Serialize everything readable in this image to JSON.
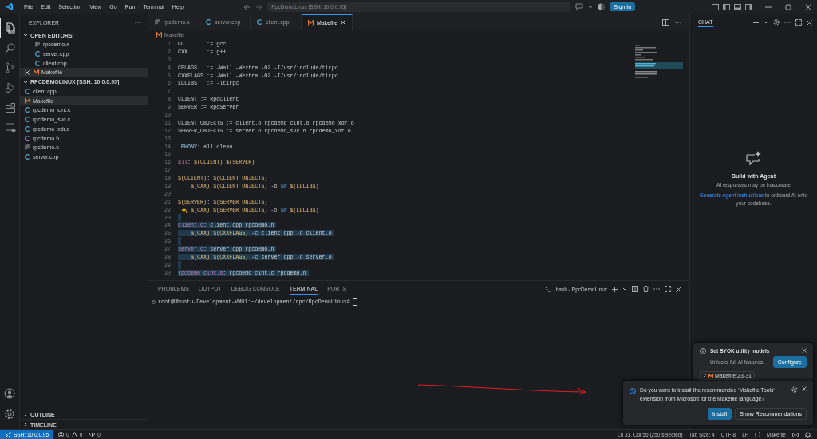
{
  "title_bar": {
    "menu": [
      "File",
      "Edit",
      "Selection",
      "View",
      "Go",
      "Run",
      "Terminal",
      "Help"
    ],
    "command_center": "RpcDemoLinux [SSH: 10.0.0.95]",
    "sign_in": "Sign In"
  },
  "activity_bar": [
    {
      "kind": "files",
      "selected": true
    },
    {
      "kind": "search",
      "selected": false
    },
    {
      "kind": "source-control",
      "selected": false
    },
    {
      "kind": "run",
      "selected": false
    },
    {
      "kind": "extensions",
      "selected": false
    },
    {
      "kind": "remote",
      "selected": false
    }
  ],
  "sidebar": {
    "title": "EXPLORER",
    "open_editors": {
      "title": "OPEN EDITORS",
      "expanded": true,
      "items": [
        {
          "name": "rpcdemo.x",
          "kind": "text",
          "selected": false
        },
        {
          "name": "server.cpp",
          "kind": "cpp",
          "selected": false
        },
        {
          "name": "client.cpp",
          "kind": "cpp",
          "selected": false
        },
        {
          "name": "Makefile",
          "kind": "makefile",
          "selected": true
        }
      ]
    },
    "folder": {
      "title": "RPCDEMOLINUX [SSH: 10.0.0.95]",
      "expanded": true,
      "items": [
        {
          "name": "client.cpp",
          "kind": "cpp",
          "selected": false
        },
        {
          "name": "Makefile",
          "kind": "makefile",
          "selected": true
        },
        {
          "name": "rpcdemo_clnt.c",
          "kind": "c",
          "selected": false
        },
        {
          "name": "rpcdemo_svc.c",
          "kind": "c",
          "selected": false
        },
        {
          "name": "rpcdemo_xdr.c",
          "kind": "c",
          "selected": false
        },
        {
          "name": "rpcdemo.h",
          "kind": "h",
          "selected": false
        },
        {
          "name": "rpcdemo.x",
          "kind": "text",
          "selected": false
        },
        {
          "name": "server.cpp",
          "kind": "cpp",
          "selected": false
        }
      ]
    },
    "collapsed_sections": [
      {
        "title": "OUTLINE",
        "expanded": false
      },
      {
        "title": "TIMELINE",
        "expanded": false
      }
    ]
  },
  "editor": {
    "tabs": [
      {
        "name": "rpcdemo.x",
        "kind": "text",
        "selected": false
      },
      {
        "name": "server.cpp",
        "kind": "cpp",
        "selected": false
      },
      {
        "name": "client.cpp",
        "kind": "cpp",
        "selected": false
      },
      {
        "name": "Makefile",
        "kind": "makefile",
        "selected": true
      }
    ],
    "breadcrumb": "Makefile",
    "lines": [
      {
        "number": "1",
        "selected": false,
        "tokens": [
          {
            "text": "CC       := gcc",
            "kind": "plain"
          }
        ]
      },
      {
        "number": "2",
        "selected": false,
        "tokens": [
          {
            "text": "CXX      := g++",
            "kind": "plain"
          }
        ]
      },
      {
        "number": "3",
        "selected": false
      },
      {
        "number": "4",
        "selected": false,
        "tokens": [
          {
            "text": "CFLAGS   := -Wall -Wextra -O2 -I/usr/include/tirpc",
            "kind": "plain"
          }
        ]
      },
      {
        "number": "5",
        "selected": false,
        "tokens": [
          {
            "text": "CXXFLAGS := -Wall -Wextra -O2 -I/usr/include/tirpc",
            "kind": "plain"
          }
        ]
      },
      {
        "number": "6",
        "selected": false,
        "tokens": [
          {
            "text": "LDLIBS   := -ltirpc",
            "kind": "plain"
          }
        ]
      },
      {
        "number": "7",
        "selected": false
      },
      {
        "number": "8",
        "selected": false,
        "tokens": [
          {
            "text": "CLIENT := RpcClient",
            "kind": "plain"
          }
        ]
      },
      {
        "number": "9",
        "selected": false,
        "tokens": [
          {
            "text": "SERVER := RpcServer",
            "kind": "plain"
          }
        ]
      },
      {
        "number": "10",
        "selected": false
      },
      {
        "number": "11",
        "selected": false,
        "tokens": [
          {
            "text": "CLIENT_OBJECTS := client.o rpcdemo_clnt.o rpcdemo_xdr.o",
            "kind": "plain"
          }
        ]
      },
      {
        "number": "12",
        "selected": false,
        "tokens": [
          {
            "text": "SERVER_OBJECTS := server.o rpcdemo_svc.o rpcdemo_xdr.o",
            "kind": "plain"
          }
        ]
      },
      {
        "number": "13",
        "selected": false
      },
      {
        "number": "14",
        "selected": false,
        "tokens": [
          {
            "text": ".PHONY",
            "kind": "special"
          },
          {
            "text": ": all clean",
            "kind": "plain"
          }
        ]
      },
      {
        "number": "15",
        "selected": false
      },
      {
        "number": "16",
        "selected": false,
        "tokens": [
          {
            "text": "all",
            "kind": "target"
          },
          {
            "text": ": ",
            "kind": "plain"
          },
          {
            "text": "$(CLIENT)",
            "kind": "variable"
          },
          {
            "text": " $(SERVER)",
            "kind": "variable"
          }
        ]
      },
      {
        "number": "17",
        "selected": false
      },
      {
        "number": "18",
        "selected": false,
        "tokens": [
          {
            "text": "$(CLIENT)",
            "kind": "variable"
          },
          {
            "text": ": ",
            "kind": "plain"
          },
          {
            "text": "$(CLIENT_OBJECTS)",
            "kind": "variable"
          }
        ]
      },
      {
        "number": "19",
        "selected": false,
        "tokens": [
          {
            "text": "    $(CXX)",
            "kind": "variable"
          },
          {
            "text": " $(CLIENT_OBJECTS)",
            "kind": "variable"
          },
          {
            "text": " -o ",
            "kind": "plain"
          },
          {
            "text": "$@",
            "kind": "auto"
          },
          {
            "text": " $(LDLIBS)",
            "kind": "variable"
          }
        ]
      },
      {
        "number": "20",
        "selected": false
      },
      {
        "number": "21",
        "selected": false,
        "tokens": [
          {
            "text": "$(SERVER)",
            "kind": "variable"
          },
          {
            "text": ": ",
            "kind": "plain"
          },
          {
            "text": "$(SERVER_OBJECTS)",
            "kind": "variable"
          }
        ]
      },
      {
        "number": "22",
        "selected": false,
        "sparkle": true,
        "tokens": [
          {
            "text": "$(CXX)",
            "kind": "variable"
          },
          {
            "text": " $(SERVER_OBJECTS)",
            "kind": "variable"
          },
          {
            "text": " -o ",
            "kind": "plain"
          },
          {
            "text": "$@",
            "kind": "auto"
          },
          {
            "text": " $(LDLIBS)",
            "kind": "variable"
          }
        ]
      },
      {
        "number": "23",
        "selected": true
      },
      {
        "number": "24",
        "selected": true,
        "tokens": [
          {
            "text": "client.o",
            "kind": "target"
          },
          {
            "text": ": client.cpp rpcdemo.h",
            "kind": "plain"
          }
        ]
      },
      {
        "number": "25",
        "selected": true,
        "tokens": [
          {
            "text": "    $(CXX)",
            "kind": "variable"
          },
          {
            "text": " $(CXXFLAGS)",
            "kind": "variable"
          },
          {
            "text": " -c client.cpp -o client.o",
            "kind": "plain"
          }
        ]
      },
      {
        "number": "26",
        "selected": true
      },
      {
        "number": "27",
        "selected": true,
        "tokens": [
          {
            "text": "server.o",
            "kind": "target"
          },
          {
            "text": ": server.cpp rpcdemo.h",
            "kind": "plain"
          }
        ]
      },
      {
        "number": "28",
        "selected": true,
        "tokens": [
          {
            "text": "    $(CXX)",
            "kind": "variable"
          },
          {
            "text": " $(CXXFLAGS)",
            "kind": "variable"
          },
          {
            "text": " -c server.cpp -o server.o",
            "kind": "plain"
          }
        ]
      },
      {
        "number": "29",
        "selected": true
      },
      {
        "number": "30",
        "selected": true,
        "tokens": [
          {
            "text": "rpcdemo_clnt.o",
            "kind": "target"
          },
          {
            "text": ": rpcdemo_clnt.c rpcdemo.h",
            "kind": "plain"
          }
        ]
      }
    ]
  },
  "panel": {
    "tabs": [
      {
        "label": "PROBLEMS",
        "selected": false
      },
      {
        "label": "OUTPUT",
        "selected": false
      },
      {
        "label": "DEBUG CONSOLE",
        "selected": false
      },
      {
        "label": "TERMINAL",
        "selected": true
      },
      {
        "label": "PORTS",
        "selected": false
      }
    ],
    "terminal_name": "bash - RpcDemoLinux",
    "prompt": "root@Ubuntu-Development-VM01:~/development/rpc/RpcDemoLinux#"
  },
  "chat": {
    "tab": "CHAT",
    "heading": "Build with Agent",
    "note": "AI responses may be inaccurate",
    "link": "Generate Agent Instructions",
    "after_link": "to onboard AI onto your codebase."
  },
  "notifications": [
    {
      "kind": "byok",
      "title": "Set BYOK utility models",
      "detail": "Unlocks full AI features.",
      "buttons": [
        {
          "label": "Configure",
          "primary": true
        }
      ],
      "context_chip": "Makefile:23-31"
    },
    {
      "kind": "recommendation",
      "message": "Do you want to install the recommended 'Makefile Tools' extension from Microsoft for the Makefile language?",
      "buttons": [
        {
          "label": "Install",
          "primary": true
        },
        {
          "label": "Show Recommendations",
          "primary": false
        }
      ]
    }
  ],
  "status_bar": {
    "remote": "SSH: 10.0.0.95",
    "errors": "0",
    "warnings": "0",
    "ports": "0",
    "items": [
      "Ln 31, Col 56 (250 selected)",
      "Tab Size: 4",
      "UTF-8",
      "LF"
    ],
    "language": "Makefile"
  }
}
